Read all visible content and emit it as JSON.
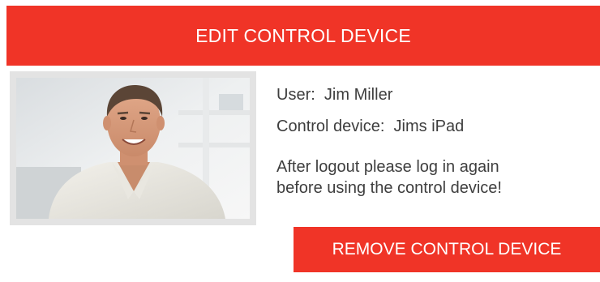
{
  "header": {
    "title": "EDIT CONTROL DEVICE",
    "color": "#f03427"
  },
  "profile": {
    "photo_icon": "user-photo",
    "user_label": "User:",
    "user_name": "Jim Miller",
    "device_label": "Control device:",
    "device_name": "Jims iPad",
    "note_line1": "After logout please log in again",
    "note_line2": "before using the control device!"
  },
  "actions": {
    "remove_label": "REMOVE CONTROL DEVICE",
    "color": "#f03427"
  }
}
